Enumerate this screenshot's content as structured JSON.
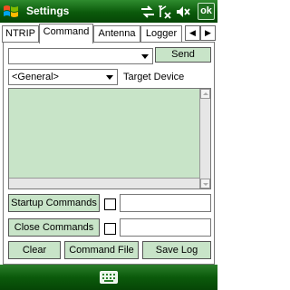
{
  "window": {
    "title": "Settings",
    "ok_label": "ok"
  },
  "tabs": [
    {
      "label": "NTRIP",
      "active": false
    },
    {
      "label": "Command",
      "active": true
    },
    {
      "label": "Antenna",
      "active": false
    },
    {
      "label": "Logger",
      "active": false
    }
  ],
  "command": {
    "command_value": "",
    "send_label": "Send",
    "target_value": "<General>",
    "target_label": "Target Device"
  },
  "actions": {
    "startup_label": "Startup Commands",
    "close_label": "Close Commands",
    "clear_label": "Clear",
    "command_file_label": "Command File",
    "save_log_label": "Save Log"
  },
  "colors": {
    "titlebar": "#0b5a0b",
    "button_face": "#c8e4c8"
  }
}
